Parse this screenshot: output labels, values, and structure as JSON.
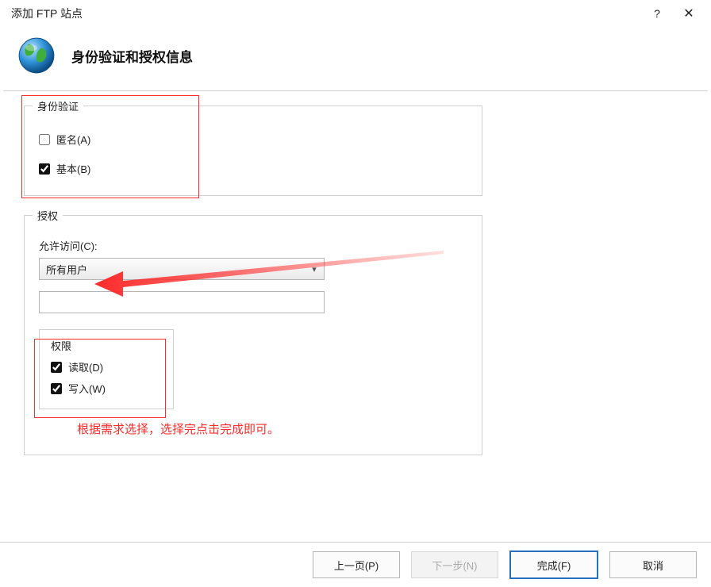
{
  "window": {
    "title": "添加 FTP 站点",
    "help_icon": "?",
    "close_icon": "✕"
  },
  "header": {
    "title": "身份验证和授权信息"
  },
  "auth_group": {
    "legend": "身份验证",
    "anonymous": {
      "label": "匿名(A)",
      "checked": false
    },
    "basic": {
      "label": "基本(B)",
      "checked": true
    }
  },
  "authz_group": {
    "legend": "授权",
    "allow_access_label": "允许访问(C):",
    "dropdown_value": "所有用户",
    "textbox_value": ""
  },
  "perm_group": {
    "legend": "权限",
    "read": {
      "label": "读取(D)",
      "checked": true
    },
    "write": {
      "label": "写入(W)",
      "checked": true
    }
  },
  "note": "根据需求选择，选择完点击完成即可。",
  "buttons": {
    "prev": "上一页(P)",
    "next": "下一步(N)",
    "finish": "完成(F)",
    "cancel": "取消"
  }
}
